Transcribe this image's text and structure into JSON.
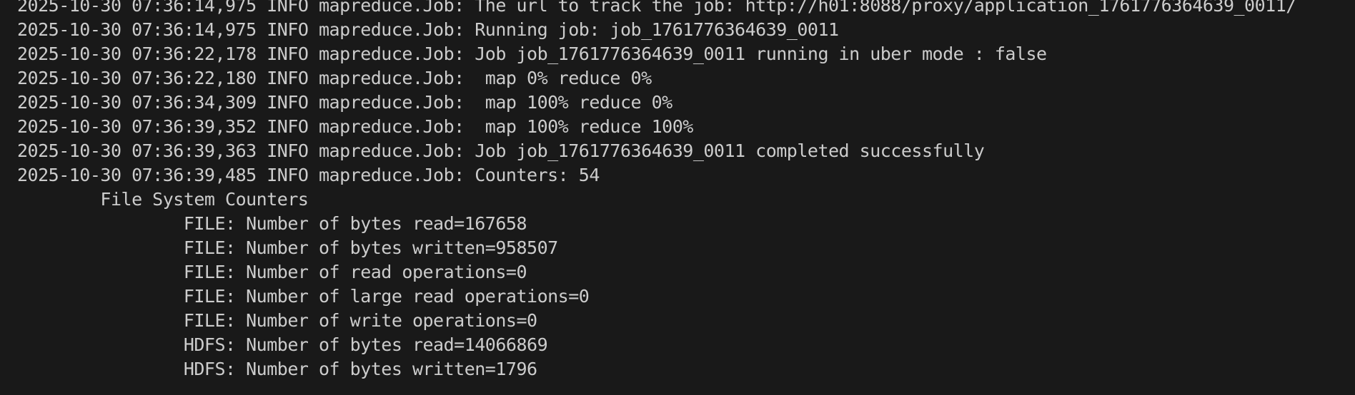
{
  "terminal": {
    "foreground": "#cccccc",
    "background": "#191919",
    "lines": [
      "2025-10-30 07:36:14,975 INFO mapreduce.Job: The url to track the job: http://h01:8088/proxy/application_1761776364639_0011/",
      "2025-10-30 07:36:14,975 INFO mapreduce.Job: Running job: job_1761776364639_0011",
      "2025-10-30 07:36:22,178 INFO mapreduce.Job: Job job_1761776364639_0011 running in uber mode : false",
      "2025-10-30 07:36:22,180 INFO mapreduce.Job:  map 0% reduce 0%",
      "2025-10-30 07:36:34,309 INFO mapreduce.Job:  map 100% reduce 0%",
      "2025-10-30 07:36:39,352 INFO mapreduce.Job:  map 100% reduce 100%",
      "2025-10-30 07:36:39,363 INFO mapreduce.Job: Job job_1761776364639_0011 completed successfully",
      "2025-10-30 07:36:39,485 INFO mapreduce.Job: Counters: 54",
      "        File System Counters",
      "                FILE: Number of bytes read=167658",
      "                FILE: Number of bytes written=958507",
      "                FILE: Number of read operations=0",
      "                FILE: Number of large read operations=0",
      "                FILE: Number of write operations=0",
      "                HDFS: Number of bytes read=14066869",
      "                HDFS: Number of bytes written=1796"
    ]
  }
}
